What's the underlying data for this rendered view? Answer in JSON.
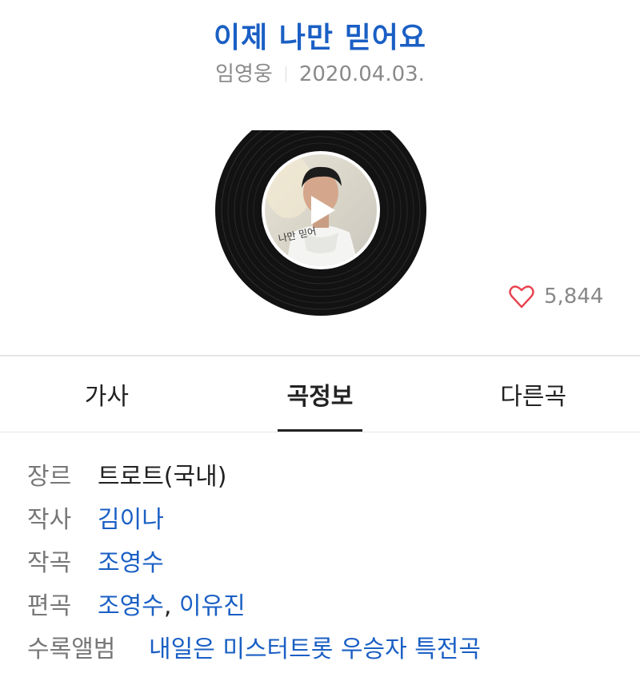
{
  "song": {
    "title": "이제 나만 믿어요",
    "artist": "임영웅",
    "release_date": "2020.04.03."
  },
  "player": {
    "play_icon": "play-icon"
  },
  "likes": {
    "count": "5,844",
    "icon": "heart-icon",
    "color": "#e8424f"
  },
  "tabs": [
    {
      "label": "가사",
      "active": false
    },
    {
      "label": "곡정보",
      "active": true
    },
    {
      "label": "다른곡",
      "active": false
    }
  ],
  "info": {
    "genre": {
      "label": "장르",
      "value": "트로트(국내)"
    },
    "lyricist": {
      "label": "작사",
      "value": "김이나"
    },
    "composer": {
      "label": "작곡",
      "value": "조영수"
    },
    "arranger": {
      "label": "편곡",
      "value1": "조영수",
      "sep": ",",
      "value2": "이유진"
    },
    "album": {
      "label": "수록앨범",
      "value": "내일은 미스터트롯 우승자 특전곡"
    }
  },
  "colors": {
    "accent": "#1a5fc4",
    "muted": "#8a8a8a"
  }
}
